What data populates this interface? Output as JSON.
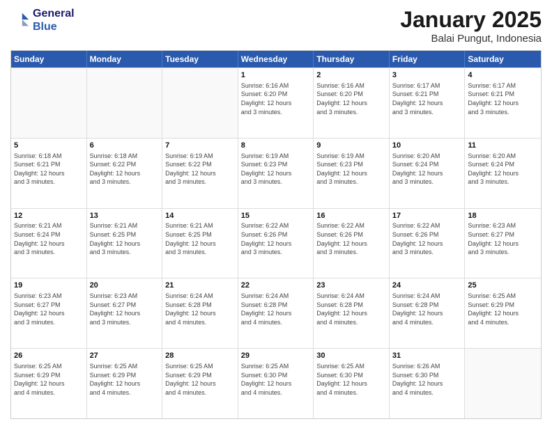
{
  "header": {
    "logo_line1": "General",
    "logo_line2": "Blue",
    "month": "January 2025",
    "location": "Balai Pungut, Indonesia"
  },
  "days_of_week": [
    "Sunday",
    "Monday",
    "Tuesday",
    "Wednesday",
    "Thursday",
    "Friday",
    "Saturday"
  ],
  "weeks": [
    [
      {
        "day": "",
        "info": ""
      },
      {
        "day": "",
        "info": ""
      },
      {
        "day": "",
        "info": ""
      },
      {
        "day": "1",
        "info": "Sunrise: 6:16 AM\nSunset: 6:20 PM\nDaylight: 12 hours\nand 3 minutes."
      },
      {
        "day": "2",
        "info": "Sunrise: 6:16 AM\nSunset: 6:20 PM\nDaylight: 12 hours\nand 3 minutes."
      },
      {
        "day": "3",
        "info": "Sunrise: 6:17 AM\nSunset: 6:21 PM\nDaylight: 12 hours\nand 3 minutes."
      },
      {
        "day": "4",
        "info": "Sunrise: 6:17 AM\nSunset: 6:21 PM\nDaylight: 12 hours\nand 3 minutes."
      }
    ],
    [
      {
        "day": "5",
        "info": "Sunrise: 6:18 AM\nSunset: 6:21 PM\nDaylight: 12 hours\nand 3 minutes."
      },
      {
        "day": "6",
        "info": "Sunrise: 6:18 AM\nSunset: 6:22 PM\nDaylight: 12 hours\nand 3 minutes."
      },
      {
        "day": "7",
        "info": "Sunrise: 6:19 AM\nSunset: 6:22 PM\nDaylight: 12 hours\nand 3 minutes."
      },
      {
        "day": "8",
        "info": "Sunrise: 6:19 AM\nSunset: 6:23 PM\nDaylight: 12 hours\nand 3 minutes."
      },
      {
        "day": "9",
        "info": "Sunrise: 6:19 AM\nSunset: 6:23 PM\nDaylight: 12 hours\nand 3 minutes."
      },
      {
        "day": "10",
        "info": "Sunrise: 6:20 AM\nSunset: 6:24 PM\nDaylight: 12 hours\nand 3 minutes."
      },
      {
        "day": "11",
        "info": "Sunrise: 6:20 AM\nSunset: 6:24 PM\nDaylight: 12 hours\nand 3 minutes."
      }
    ],
    [
      {
        "day": "12",
        "info": "Sunrise: 6:21 AM\nSunset: 6:24 PM\nDaylight: 12 hours\nand 3 minutes."
      },
      {
        "day": "13",
        "info": "Sunrise: 6:21 AM\nSunset: 6:25 PM\nDaylight: 12 hours\nand 3 minutes."
      },
      {
        "day": "14",
        "info": "Sunrise: 6:21 AM\nSunset: 6:25 PM\nDaylight: 12 hours\nand 3 minutes."
      },
      {
        "day": "15",
        "info": "Sunrise: 6:22 AM\nSunset: 6:26 PM\nDaylight: 12 hours\nand 3 minutes."
      },
      {
        "day": "16",
        "info": "Sunrise: 6:22 AM\nSunset: 6:26 PM\nDaylight: 12 hours\nand 3 minutes."
      },
      {
        "day": "17",
        "info": "Sunrise: 6:22 AM\nSunset: 6:26 PM\nDaylight: 12 hours\nand 3 minutes."
      },
      {
        "day": "18",
        "info": "Sunrise: 6:23 AM\nSunset: 6:27 PM\nDaylight: 12 hours\nand 3 minutes."
      }
    ],
    [
      {
        "day": "19",
        "info": "Sunrise: 6:23 AM\nSunset: 6:27 PM\nDaylight: 12 hours\nand 3 minutes."
      },
      {
        "day": "20",
        "info": "Sunrise: 6:23 AM\nSunset: 6:27 PM\nDaylight: 12 hours\nand 3 minutes."
      },
      {
        "day": "21",
        "info": "Sunrise: 6:24 AM\nSunset: 6:28 PM\nDaylight: 12 hours\nand 4 minutes."
      },
      {
        "day": "22",
        "info": "Sunrise: 6:24 AM\nSunset: 6:28 PM\nDaylight: 12 hours\nand 4 minutes."
      },
      {
        "day": "23",
        "info": "Sunrise: 6:24 AM\nSunset: 6:28 PM\nDaylight: 12 hours\nand 4 minutes."
      },
      {
        "day": "24",
        "info": "Sunrise: 6:24 AM\nSunset: 6:28 PM\nDaylight: 12 hours\nand 4 minutes."
      },
      {
        "day": "25",
        "info": "Sunrise: 6:25 AM\nSunset: 6:29 PM\nDaylight: 12 hours\nand 4 minutes."
      }
    ],
    [
      {
        "day": "26",
        "info": "Sunrise: 6:25 AM\nSunset: 6:29 PM\nDaylight: 12 hours\nand 4 minutes."
      },
      {
        "day": "27",
        "info": "Sunrise: 6:25 AM\nSunset: 6:29 PM\nDaylight: 12 hours\nand 4 minutes."
      },
      {
        "day": "28",
        "info": "Sunrise: 6:25 AM\nSunset: 6:29 PM\nDaylight: 12 hours\nand 4 minutes."
      },
      {
        "day": "29",
        "info": "Sunrise: 6:25 AM\nSunset: 6:30 PM\nDaylight: 12 hours\nand 4 minutes."
      },
      {
        "day": "30",
        "info": "Sunrise: 6:25 AM\nSunset: 6:30 PM\nDaylight: 12 hours\nand 4 minutes."
      },
      {
        "day": "31",
        "info": "Sunrise: 6:26 AM\nSunset: 6:30 PM\nDaylight: 12 hours\nand 4 minutes."
      },
      {
        "day": "",
        "info": ""
      }
    ]
  ]
}
